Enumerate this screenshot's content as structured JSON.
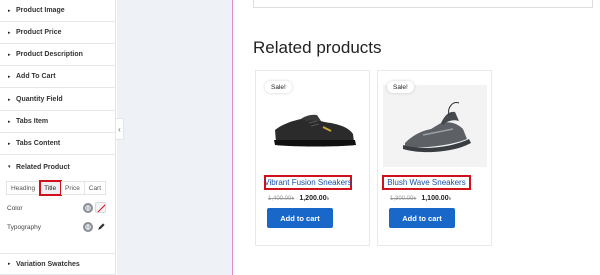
{
  "panel": {
    "sections": [
      {
        "label": "Product Image"
      },
      {
        "label": "Product Price"
      },
      {
        "label": "Product Description"
      },
      {
        "label": "Add To Cart"
      },
      {
        "label": "Quantity Field"
      },
      {
        "label": "Tabs Item"
      },
      {
        "label": "Tabs Content"
      },
      {
        "label": "Related Product"
      },
      {
        "label": "Variation Swatches"
      }
    ],
    "collapsed_arrow": "▸",
    "expanded_arrow": "▾",
    "style_tabs": [
      "Heading",
      "Title",
      "Price",
      "Cart"
    ],
    "active_tab": "Title",
    "color_label": "Color",
    "typography_label": "Typography",
    "collapse_handle_icon": "‹"
  },
  "main": {
    "heading": "Related products",
    "products": [
      {
        "badge": "Sale!",
        "title": "Vibrant Fusion Sneakers",
        "old_price": "1,400.00৳",
        "new_price": "1,200.00",
        "currency": "৳",
        "button": "Add to cart"
      },
      {
        "badge": "Sale!",
        "title": "Blush Wave Sneakers",
        "old_price": "1,300.00৳",
        "new_price": "1,100.00",
        "currency": "৳",
        "button": "Add to cart"
      }
    ]
  },
  "colors": {
    "highlight": "#d0111b",
    "button": "#1867c9",
    "title_link": "#1a4fa5",
    "canvas": "#eef1f5",
    "page_edge": "#e889c9"
  },
  "icons": [
    "globe-icon",
    "color-swatch-icon",
    "pencil-icon",
    "sneaker-dark-icon",
    "sneaker-grey-icon"
  ]
}
